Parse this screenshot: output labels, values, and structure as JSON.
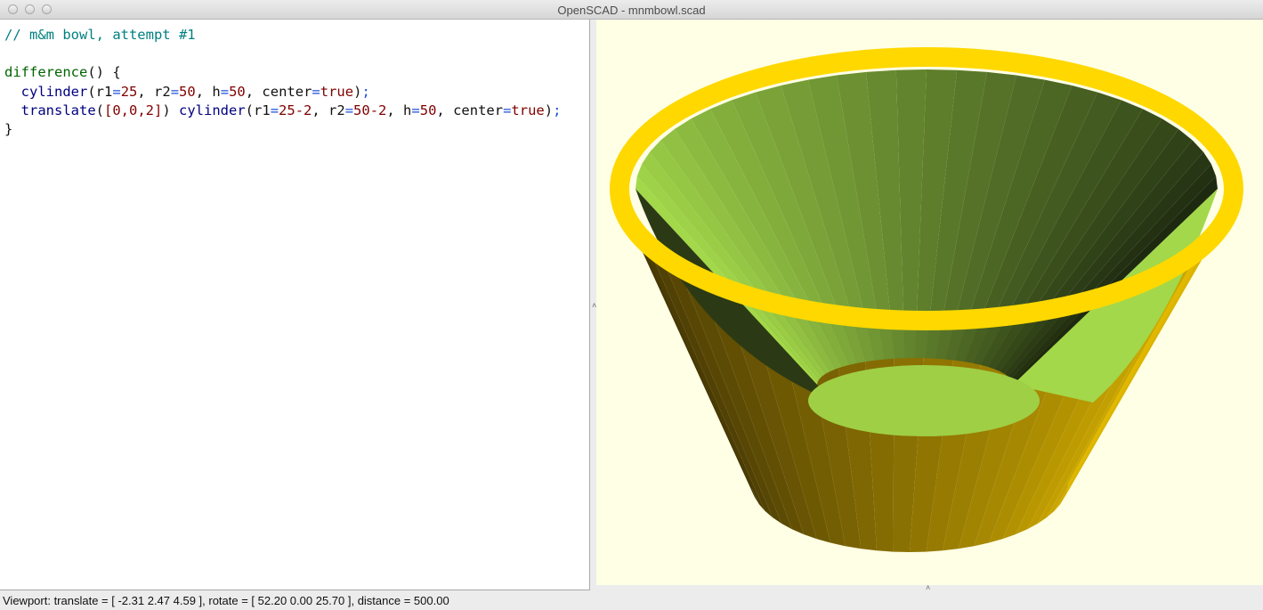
{
  "window": {
    "title": "OpenSCAD - mnmbowl.scad"
  },
  "editor": {
    "comment": "// m&m bowl, attempt #1",
    "code": {
      "difference": "difference",
      "difference_tail": "() {",
      "cylinder": "cylinder",
      "translate": "translate",
      "close": "}",
      "r1_label": "r1",
      "r2_label": "r2",
      "h_label": "h",
      "center_label": "center",
      "r1_val": "25",
      "r2_val": "50",
      "h_val": "50",
      "true_val": "true",
      "tvec": "[0,0,2]",
      "r1b_val": "25-2",
      "r2b_val": "50-2"
    }
  },
  "status": {
    "viewport": "Viewport: translate = [ -2.31 2.47 4.59 ], rotate = [ 52.20 0.00 25.70 ], distance = 500.00"
  },
  "colors": {
    "viewer_bg": "#ffffe6",
    "rim": "#ffd800",
    "outer_wall": "#c9a400",
    "inner_wall": "#86b13b"
  }
}
